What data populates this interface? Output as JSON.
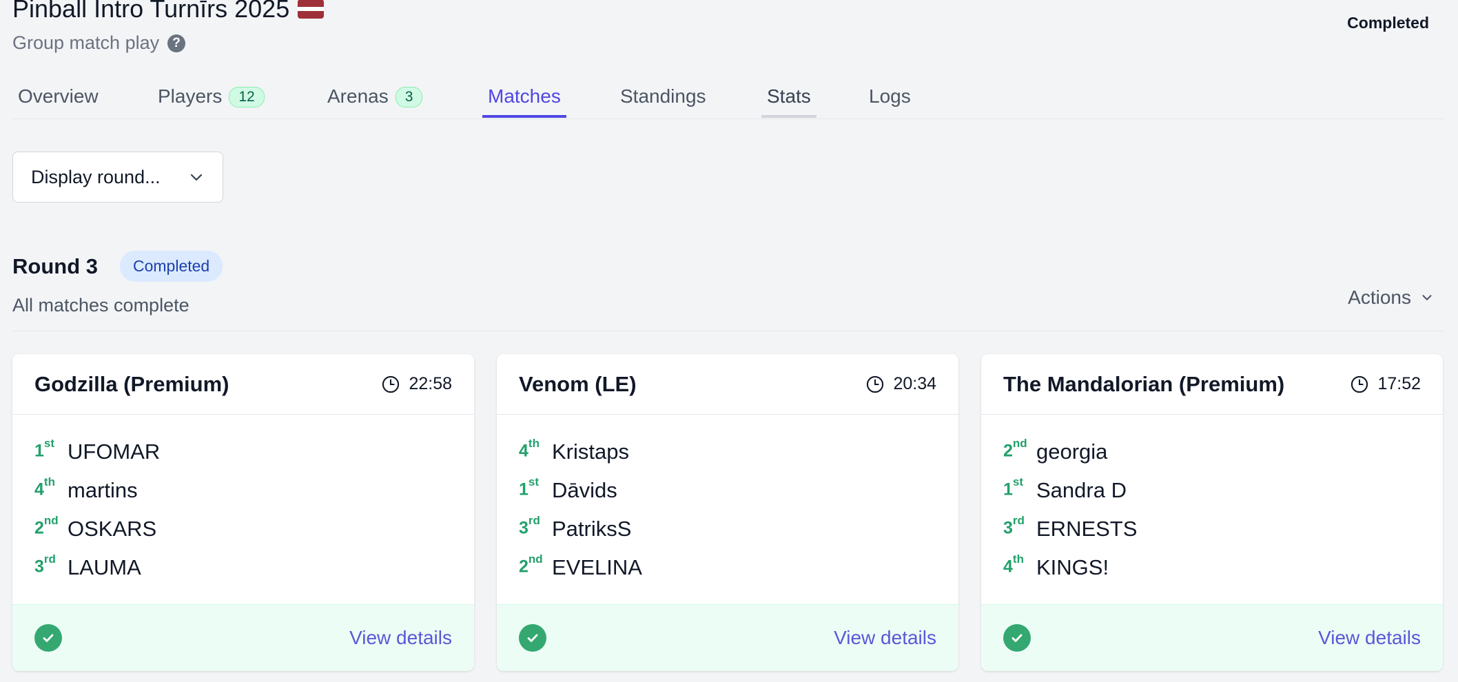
{
  "header": {
    "title": "Pinball Intro Turnīrs 2025",
    "subtitle": "Group match play",
    "status": "Completed"
  },
  "tabs": [
    {
      "label": "Overview"
    },
    {
      "label": "Players",
      "count": "12"
    },
    {
      "label": "Arenas",
      "count": "3"
    },
    {
      "label": "Matches",
      "active": true
    },
    {
      "label": "Standings"
    },
    {
      "label": "Stats"
    },
    {
      "label": "Logs"
    }
  ],
  "round_select": {
    "value": "Display round..."
  },
  "round": {
    "title": "Round 3",
    "badge": "Completed",
    "subtitle": "All matches complete",
    "actions_label": "Actions"
  },
  "colors": {
    "accent": "#4f46e5",
    "success": "#34a870",
    "position": "#22a06b"
  },
  "cards": [
    {
      "title": "Godzilla (Premium)",
      "time": "22:58",
      "players": [
        {
          "pos": "1",
          "suffix": "st",
          "name": "UFOMAR"
        },
        {
          "pos": "4",
          "suffix": "th",
          "name": "martins"
        },
        {
          "pos": "2",
          "suffix": "nd",
          "name": "OSKARS"
        },
        {
          "pos": "3",
          "suffix": "rd",
          "name": "LAUMA"
        }
      ],
      "link": "View details"
    },
    {
      "title": "Venom (LE)",
      "time": "20:34",
      "players": [
        {
          "pos": "4",
          "suffix": "th",
          "name": "Kristaps"
        },
        {
          "pos": "1",
          "suffix": "st",
          "name": "Dāvids"
        },
        {
          "pos": "3",
          "suffix": "rd",
          "name": "PatriksS"
        },
        {
          "pos": "2",
          "suffix": "nd",
          "name": "EVELINA"
        }
      ],
      "link": "View details"
    },
    {
      "title": "The Mandalorian (Premium)",
      "time": "17:52",
      "players": [
        {
          "pos": "2",
          "suffix": "nd",
          "name": "georgia"
        },
        {
          "pos": "1",
          "suffix": "st",
          "name": "Sandra D"
        },
        {
          "pos": "3",
          "suffix": "rd",
          "name": "ERNESTS"
        },
        {
          "pos": "4",
          "suffix": "th",
          "name": "KINGS!"
        }
      ],
      "link": "View details"
    }
  ]
}
